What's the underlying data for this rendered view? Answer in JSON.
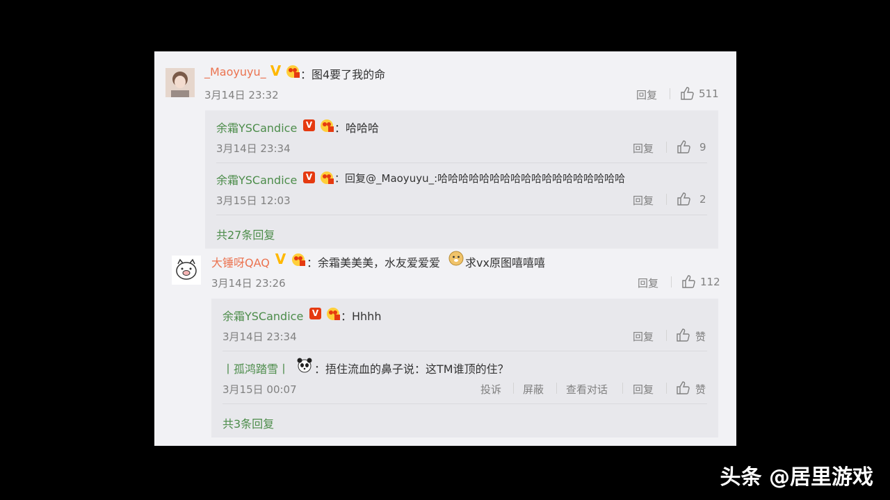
{
  "comments": [
    {
      "user": "_Maoyuyu_",
      "text": "：图4要了我的命",
      "time": "3月14日 23:32",
      "reply_label": "回复",
      "likes": "511",
      "replies": [
        {
          "user": "余霜YSCandice",
          "text": "：哈哈哈",
          "time": "3月14日 23:34",
          "reply_label": "回复",
          "likes": "9"
        },
        {
          "user": "余霜YSCandice",
          "text": "：回复@_Maoyuyu_:哈哈哈哈哈哈哈哈哈哈哈哈哈哈哈哈哈哈",
          "time": "3月15日 12:03",
          "reply_label": "回复",
          "likes": "2"
        }
      ],
      "more_replies": "共27条回复"
    },
    {
      "user": "大锤呀QAQ",
      "text_before": "：余霜美美美，水友爱爱爱",
      "text_after": "求vx原图嘻嘻嘻",
      "time": "3月14日 23:26",
      "reply_label": "回复",
      "likes": "112",
      "replies": [
        {
          "user": "余霜YSCandice",
          "text": "：Hhhh",
          "time": "3月14日 23:34",
          "reply_label": "回复",
          "likes": "赞"
        },
        {
          "user": "丨孤鸿踏雪丨",
          "text": "：捂住流血的鼻子说：这TM谁顶的住？",
          "time": "3月15日 00:07",
          "report_label": "投诉",
          "block_label": "屏蔽",
          "view_conversation_label": "查看对话",
          "reply_label": "回复",
          "likes": "赞"
        }
      ],
      "more_replies": "共3条回复"
    }
  ],
  "watermark": "头条 @居里游戏",
  "colors": {
    "name": "#eb7350",
    "reply_name": "#4c8c4a",
    "vip": "#ff8200",
    "background": "#f2f2f5"
  }
}
